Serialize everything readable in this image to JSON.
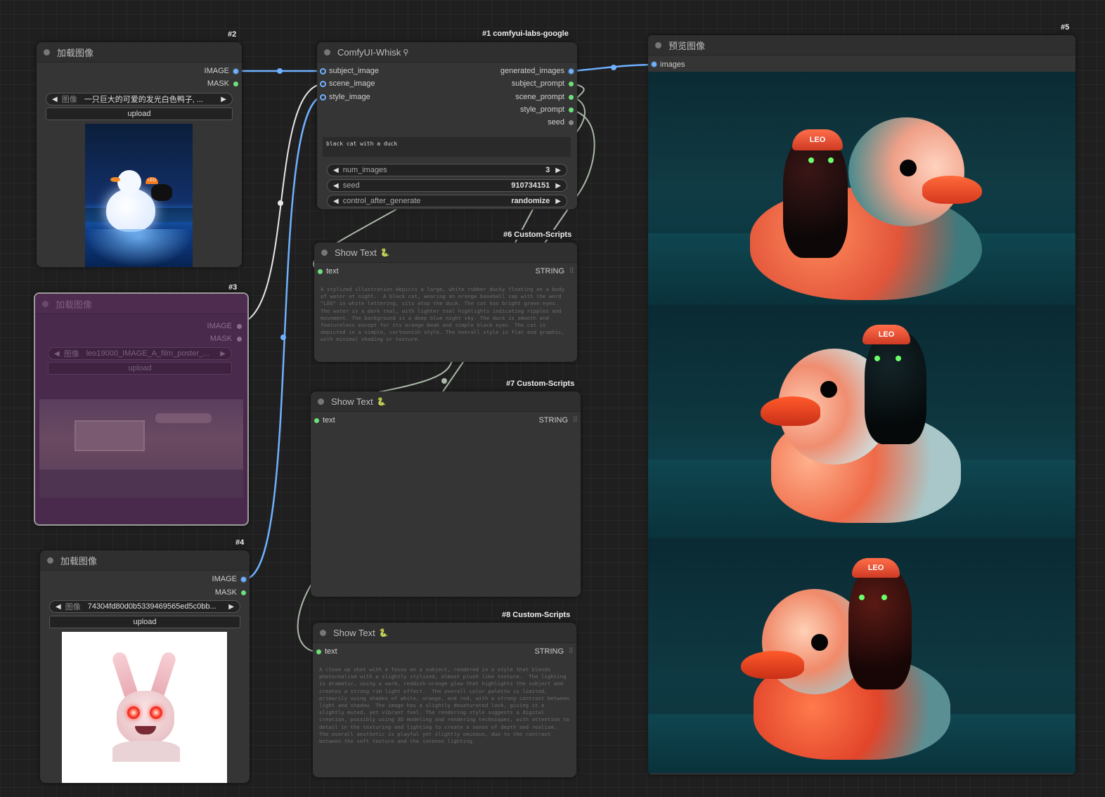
{
  "nodes": {
    "load1": {
      "badge": "#2",
      "title": "加载图像",
      "out_image": "IMAGE",
      "out_mask": "MASK",
      "widget_label": "图像",
      "widget_value": "一只巨大的可爱的发光白色鸭子, ...",
      "upload": "upload",
      "thumb_text": "LEO"
    },
    "load2": {
      "badge": "#3",
      "title": "加载图像",
      "out_image": "IMAGE",
      "out_mask": "MASK",
      "widget_label": "图像",
      "widget_value": "leo19000_IMAGE_A_film_poster_...",
      "upload": "upload"
    },
    "load3": {
      "badge": "#4",
      "title": "加载图像",
      "out_image": "IMAGE",
      "out_mask": "MASK",
      "widget_label": "图像",
      "widget_value": "74304fd80d0b5339469565ed5c0bb...",
      "upload": "upload"
    },
    "whisk": {
      "badge": "#1 comfyui-labs-google",
      "title": "ComfyUI-Whisk",
      "inputs": [
        "subject_image",
        "scene_image",
        "style_image"
      ],
      "outputs": [
        "generated_images",
        "subject_prompt",
        "scene_prompt",
        "style_prompt",
        "seed"
      ],
      "prompt": "black cat with a duck",
      "widgets": [
        {
          "label": "num_images",
          "value": "3"
        },
        {
          "label": "seed",
          "value": "910734151"
        },
        {
          "label": "control_after_generate",
          "value": "randomize"
        }
      ]
    },
    "show1": {
      "badge": "#6 Custom-Scripts",
      "title": "Show Text",
      "input": "text",
      "type": "STRING",
      "content": "A stylized illustration depicts a large, white rubber ducky floating on a body of water at night.  A black cat, wearing an orange baseball cap with the word \"LEO\" in white lettering, sits atop the duck. The cat has bright green eyes. The water is a dark teal, with lighter teal highlights indicating ripples and movement. The background is a deep blue night sky. The duck is smooth and featureless except for its orange beak and simple black eyes. The cat is depicted in a simple, cartoonish style. The overall style is flat and graphic, with minimal shading or texture."
    },
    "show2": {
      "badge": "#7 Custom-Scripts",
      "title": "Show Text",
      "input": "text",
      "type": "STRING",
      "content": ""
    },
    "show3": {
      "badge": "#8 Custom-Scripts",
      "title": "Show Text",
      "input": "text",
      "type": "STRING",
      "content": "A close up shot with a focus on a subject, rendered in a style that blends photorealism with a slightly stylized, almost plush like texture.  The lighting is dramatic, using a warm, reddish-orange glow that highlights the subject and creates a strong rim light effect.  The overall color palette is limited, primarily using shades of white, orange, and red, with a strong contrast between light and shadow. The image has a slightly desaturated look, giving it a slightly muted, yet vibrant feel. The rendering style suggests a digital creation, possibly using 3D modeling and rendering techniques, with attention to detail in the texturing and lighting to create a sense of depth and realism.  The overall aesthetic is playful yet slightly ominous, due to the contrast between the soft texture and the intense lighting."
    },
    "preview": {
      "badge": "#5",
      "title": "预览图像",
      "input": "images",
      "cap_text": "LEO"
    }
  },
  "colors": {
    "image_port": "#6fb1ff",
    "string_port": "#6ee07a",
    "muted_node": "#5c2a5c"
  }
}
